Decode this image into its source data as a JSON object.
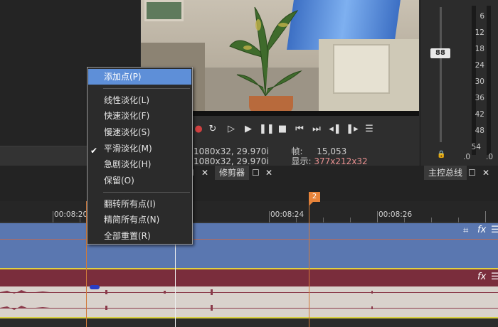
{
  "context_menu": {
    "items": [
      {
        "label": "添加点(P)"
      },
      {
        "label": "线性淡化(L)"
      },
      {
        "label": "快速淡化(F)"
      },
      {
        "label": "慢速淡化(S)"
      },
      {
        "label": "平滑淡化(M)"
      },
      {
        "label": "急剧淡化(H)"
      },
      {
        "label": "保留(O)"
      },
      {
        "label": "翻转所有点(I)"
      },
      {
        "label": "精简所有点(N)"
      },
      {
        "label": "全部重置(R)"
      }
    ],
    "checked_item": "平滑淡化(M)",
    "highlighted_item": "添加点(P)"
  },
  "preview_info": {
    "row1_value": "1080x32, 29.970i",
    "row2_value": "1080x32, 29.970i",
    "frame_label": "帧:",
    "frame_value": "15,053",
    "display_label": "显示:",
    "display_value": "377x212x32"
  },
  "tabs": {
    "trimmer": "修剪器",
    "master_bus": "主控总线"
  },
  "master": {
    "fader_value": "88",
    "db_scale": [
      "6",
      "12",
      "18",
      "24",
      "30",
      "36",
      "42",
      "48",
      "54"
    ],
    "bottom_left": ".0",
    "bottom_right": ".0"
  },
  "timeline": {
    "times": [
      "00:08:20",
      "00:08:24",
      "00:08:26"
    ],
    "marker": "2"
  },
  "icons": {
    "crop": "crop-icon",
    "fx": "fx-icon",
    "menu": "menu-icon"
  }
}
